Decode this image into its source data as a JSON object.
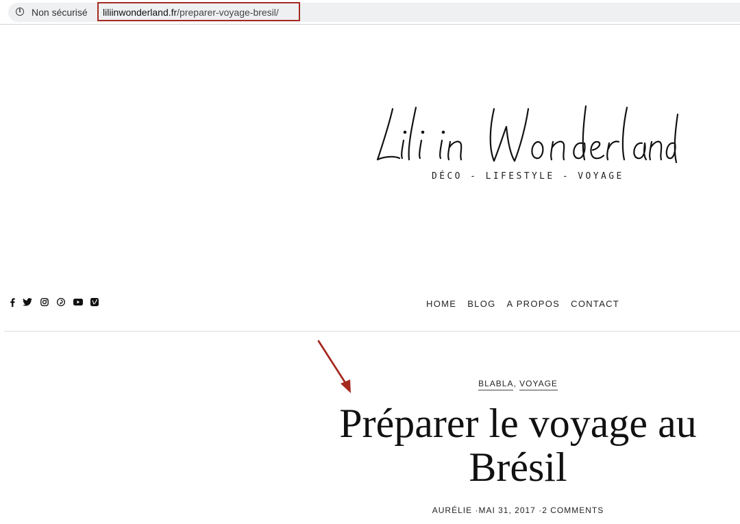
{
  "browser": {
    "security_label": "Non sécurisé",
    "url_domain": "liliinwonderland.fr",
    "url_path": "/preparer-voyage-bresil/",
    "highlight_color": "#a42a20"
  },
  "header": {
    "logo_text": "Lili in Wonderland",
    "tagline": "DÉCO - LIFESTYLE - VOYAGE"
  },
  "social": {
    "icons": [
      "facebook-icon",
      "twitter-icon",
      "instagram-icon",
      "pinterest-icon",
      "youtube-icon",
      "vimeo-icon"
    ]
  },
  "nav": {
    "items": [
      "HOME",
      "BLOG",
      "A PROPOS",
      "CONTACT"
    ]
  },
  "post": {
    "categories": [
      "BLABLA",
      "VOYAGE"
    ],
    "category_separator": ", ",
    "title_line1": "Préparer le voyage au",
    "title_line2": "Brésil",
    "author": "AURÉLIE",
    "date": "MAI 31, 2017",
    "comments": "2 COMMENTS",
    "meta_separator": "·"
  }
}
